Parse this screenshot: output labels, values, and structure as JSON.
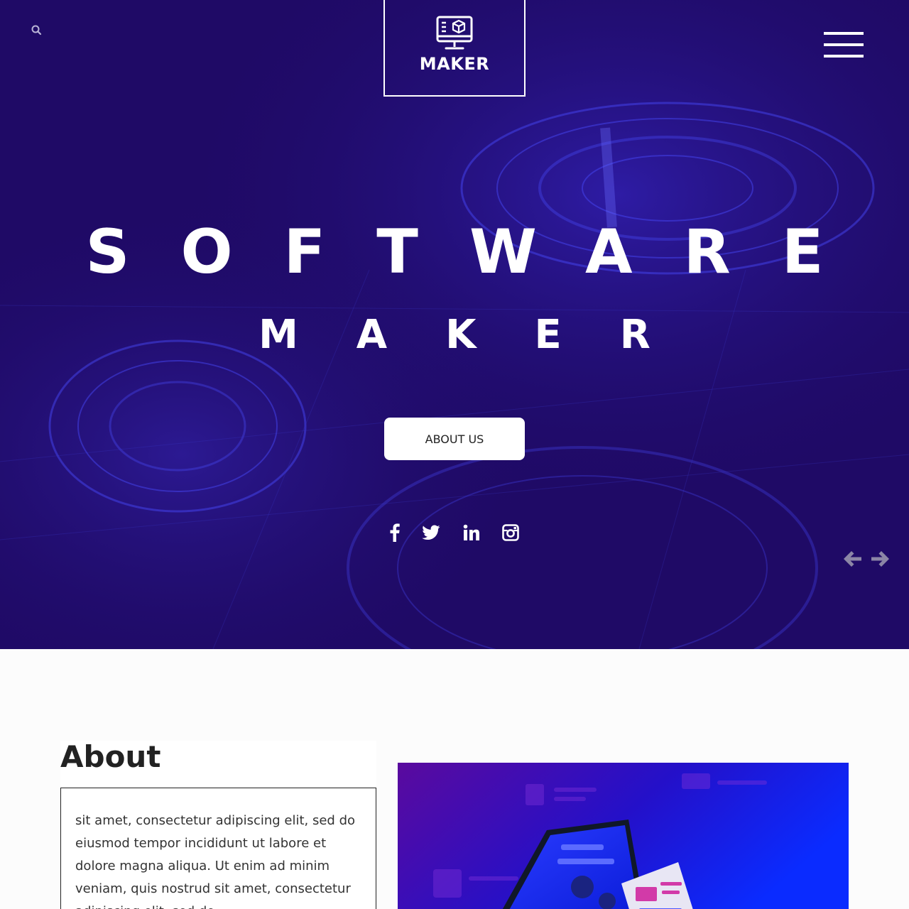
{
  "header": {
    "logo_text": "MAKER",
    "search_icon": "search-icon",
    "menu_icon": "hamburger-menu-icon"
  },
  "hero": {
    "title": "SOFTWARE",
    "subtitle": "MAKER",
    "cta_label": "ABOUT US",
    "social_icons": [
      "facebook-icon",
      "twitter-icon",
      "linkedin-icon",
      "instagram-icon"
    ],
    "slider_arrows": [
      "arrow-left-icon",
      "arrow-right-icon"
    ]
  },
  "about": {
    "heading": "About",
    "body": "sit amet, consectetur adipiscing elit, sed do eiusmod tempor incididunt ut labore et dolore magna aliqua. Ut enim ad minim veniam, quis nostrud sit amet, consectetur adipiscing elit, sed do"
  },
  "colors": {
    "hero_bg": "#1f0a66",
    "accent_blue": "#2a3cff",
    "white": "#ffffff",
    "text_dark": "#222222"
  }
}
